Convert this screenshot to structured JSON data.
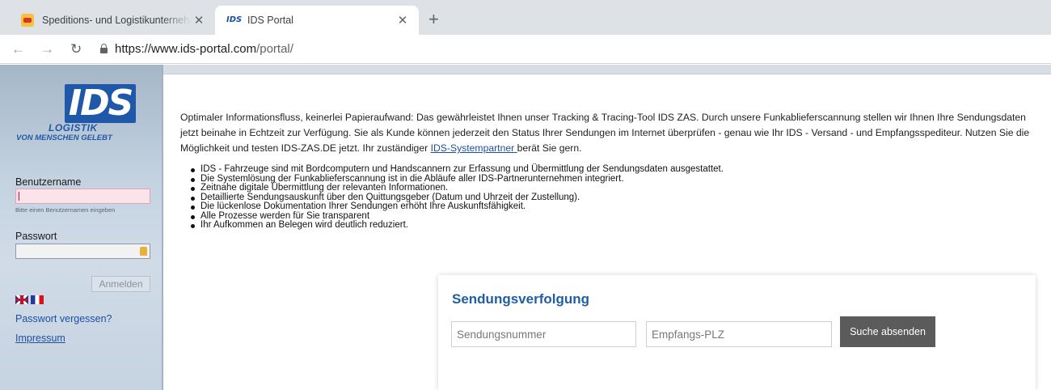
{
  "browser": {
    "tabs": [
      {
        "title": "Speditions- und Logistikunternehmen",
        "active": false
      },
      {
        "title": "IDS Portal",
        "active": true
      }
    ],
    "url": {
      "scheme": "https://",
      "host": "www.ids-portal.com",
      "path": "/portal/"
    }
  },
  "sidebar": {
    "logo": {
      "mark": "IDS",
      "word": "LOGISTIK",
      "slogan": "VON MENSCHEN GELEBT"
    },
    "username_label": "Benutzername",
    "username_hint": "Bitte einen Benutzernamen eingeben",
    "password_label": "Passwort",
    "login_button": "Anmelden",
    "forgot_password": "Passwort vergessen?",
    "impressum": "Impressum"
  },
  "main": {
    "intro_before_link": "Optimaler Informationsfluss, keinerlei Papieraufwand: Das gewährleistet Ihnen unser Tracking & Tracing-Tool IDS ZAS. Durch unsere Funkablieferscannung stellen wir Ihnen Ihre Sendungsdaten jetzt beinahe in Echtzeit zur Verfügung. Sie als Kunde können jederzeit den Status Ihrer Sendungen im Internet überprüfen - genau wie Ihr IDS - Versand - und Empfangsspediteur. Nutzen Sie die Möglichkeit und testen IDS-ZAS.DE jetzt. Ihr zuständiger ",
    "intro_link": "IDS-Systempartner ",
    "intro_after_link": "berät Sie gern.",
    "bullets": [
      "IDS - Fahrzeuge sind mit Bordcomputern und Handscannern zur Erfassung und Übermittlung der Sendungsdaten ausgestattet.",
      "Die Systemlösung der Funkablieferscannung ist in die Abläufe aller IDS-Partnerunternehmen integriert.",
      "Zeitnahe digitale Übermittlung der relevanten Informationen.",
      "Detaillierte Sendungsauskunft über den Quittungsgeber (Datum und Uhrzeit der Zustellung).",
      "Die lückenlose Dokumentation Ihrer Sendungen erhöht Ihre Auskunftsfähigkeit.",
      "Alle Prozesse werden für Sie transparent",
      "Ihr Aufkommen an Belegen wird deutlich reduziert."
    ]
  },
  "tracking": {
    "title": "Sendungsverfolgung",
    "number_placeholder": "Sendungsnummer",
    "plz_placeholder": "Empfangs-PLZ",
    "submit": "Suche absenden"
  }
}
